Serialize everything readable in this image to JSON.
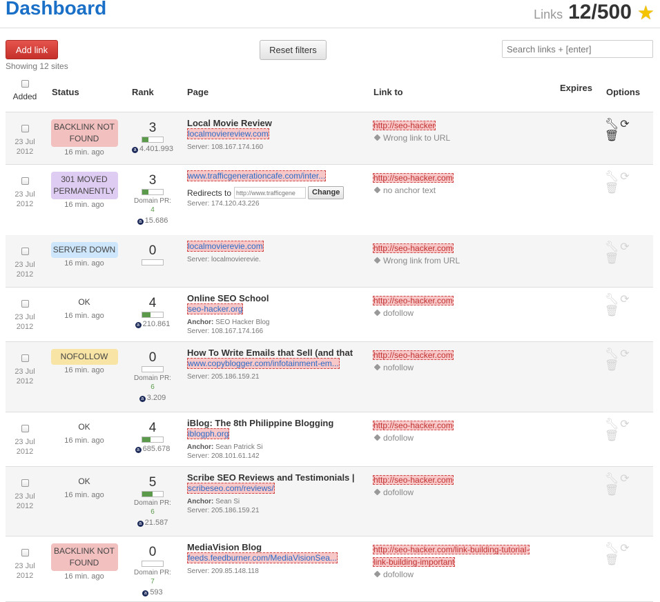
{
  "header": {
    "title": "Dashboard",
    "links_label": "Links",
    "links_count": "12/500"
  },
  "toolbar": {
    "add_link": "Add link",
    "reset_filters": "Reset filters",
    "search_placeholder": "Search links + [enter]",
    "showing": "Showing 12 sites"
  },
  "columns": {
    "added": "Added",
    "status": "Status",
    "rank": "Rank",
    "page": "Page",
    "link_to": "Link to",
    "expires": "Expires",
    "options": "Options"
  },
  "rows": [
    {
      "date": [
        "23 Jul",
        "2012"
      ],
      "status": "BACKLINK NOT FOUND",
      "status_color": "#f3c0c0",
      "ago": "16 min. ago",
      "rank": "3",
      "rank_fill": 0.3,
      "dpr_label": "",
      "dpr_value": "",
      "alexa": "4.401.993",
      "title": "Local Movie Review",
      "url": "localmoviereview.com",
      "redirect": "",
      "redirect_value": "",
      "redirect_btn": "",
      "anchor_label": "",
      "anchor": "",
      "server": "Server: 108.167.174.160",
      "link_to": "http://seo-hacker",
      "link_to_2": "",
      "tag": "Wrong link to URL",
      "options_active": true
    },
    {
      "date": [
        "23 Jul",
        "2012"
      ],
      "status": "301 MOVED PERMANENTLY",
      "status_color": "#dfccf2",
      "ago": "16 min. ago",
      "rank": "3",
      "rank_fill": 0.3,
      "dpr_label": "Domain PR:",
      "dpr_value": "4",
      "alexa": "15.686",
      "title": "",
      "url": "www.trafficgenerationcafe.com/inter...",
      "redirect": "Redirects to",
      "redirect_value": "http://www.trafficgene",
      "redirect_btn": "Change",
      "anchor_label": "",
      "anchor": "",
      "server": "Server: 174.120.43.226",
      "link_to": "http://seo-hacker.com",
      "link_to_2": "",
      "tag": "no anchor text",
      "options_active": false
    },
    {
      "date": [
        "23 Jul",
        "2012"
      ],
      "status": "SERVER DOWN",
      "status_color": "#cde6fb",
      "ago": "16 min. ago",
      "rank": "0",
      "rank_fill": 0,
      "dpr_label": "",
      "dpr_value": "",
      "alexa": "",
      "title": "",
      "url": "localmovierevie.com",
      "redirect": "",
      "redirect_value": "",
      "redirect_btn": "",
      "anchor_label": "",
      "anchor": "",
      "server": "Server: localmovierevie.",
      "link_to": "http://seo-hacker.com",
      "link_to_2": "",
      "tag": "Wrong link from URL",
      "options_active": false
    },
    {
      "date": [
        "23 Jul",
        "2012"
      ],
      "status": "OK",
      "status_color": "transparent",
      "ago": "16 min. ago",
      "rank": "4",
      "rank_fill": 0.4,
      "dpr_label": "",
      "dpr_value": "",
      "alexa": "210.861",
      "title": "Online SEO School",
      "url": "seo-hacker.org",
      "redirect": "",
      "redirect_value": "",
      "redirect_btn": "",
      "anchor_label": "Anchor:",
      "anchor": "SEO Hacker Blog",
      "server": "Server: 108.167.174.166",
      "link_to": "http://seo-hacker.com",
      "link_to_2": "",
      "tag": "dofollow",
      "options_active": false
    },
    {
      "date": [
        "23 Jul",
        "2012"
      ],
      "status": "NOFOLLOW",
      "status_color": "#f8e4a4",
      "ago": "16 min. ago",
      "rank": "0",
      "rank_fill": 0,
      "dpr_label": "Domain PR:",
      "dpr_value": "6",
      "alexa": "3.209",
      "title": "How To Write Emails that Sell (and that",
      "url": "www.copyblogger.com/infotainment-em...",
      "redirect": "",
      "redirect_value": "",
      "redirect_btn": "",
      "anchor_label": "",
      "anchor": "",
      "server": "Server: 205.186.159.21",
      "link_to": "http://seo-hacker.com",
      "link_to_2": "",
      "tag": "nofollow",
      "options_active": false
    },
    {
      "date": [
        "23 Jul",
        "2012"
      ],
      "status": "OK",
      "status_color": "transparent",
      "ago": "16 min. ago",
      "rank": "4",
      "rank_fill": 0.4,
      "dpr_label": "",
      "dpr_value": "",
      "alexa": "685.678",
      "title": "iBlog: The 8th Philippine Blogging",
      "url": "iblogph.org",
      "redirect": "",
      "redirect_value": "",
      "redirect_btn": "",
      "anchor_label": "Anchor:",
      "anchor": "Sean Patrick Si",
      "server": "Server: 208.101.61.142",
      "link_to": "http://seo-hacker.com",
      "link_to_2": "",
      "tag": "dofollow",
      "options_active": false
    },
    {
      "date": [
        "23 Jul",
        "2012"
      ],
      "status": "OK",
      "status_color": "transparent",
      "ago": "16 min. ago",
      "rank": "5",
      "rank_fill": 0.5,
      "dpr_label": "Domain PR:",
      "dpr_value": "6",
      "alexa": "21.587",
      "title": "Scribe SEO Reviews and Testimonials |",
      "url": "scribeseo.com/reviews/",
      "redirect": "",
      "redirect_value": "",
      "redirect_btn": "",
      "anchor_label": "Anchor:",
      "anchor": "Sean Si",
      "server": "Server: 205.186.159.21",
      "link_to": "http://seo-hacker.com",
      "link_to_2": "",
      "tag": "dofollow",
      "options_active": false
    },
    {
      "date": [
        "23 Jul",
        "2012"
      ],
      "status": "BACKLINK NOT FOUND",
      "status_color": "#f3c0c0",
      "ago": "16 min. ago",
      "rank": "0",
      "rank_fill": 0,
      "dpr_label": "Domain PR:",
      "dpr_value": "7",
      "alexa": "593",
      "title": "MediaVision Blog",
      "url": "feeds.feedburner.com/MediaVisionSea...",
      "redirect": "",
      "redirect_value": "",
      "redirect_btn": "",
      "anchor_label": "",
      "anchor": "",
      "server": "Server: 209.85.148.118",
      "link_to": "http://seo-hacker.com/link-building-tutorial-",
      "link_to_2": "link-building-important",
      "tag": "dofollow",
      "options_active": false
    }
  ]
}
